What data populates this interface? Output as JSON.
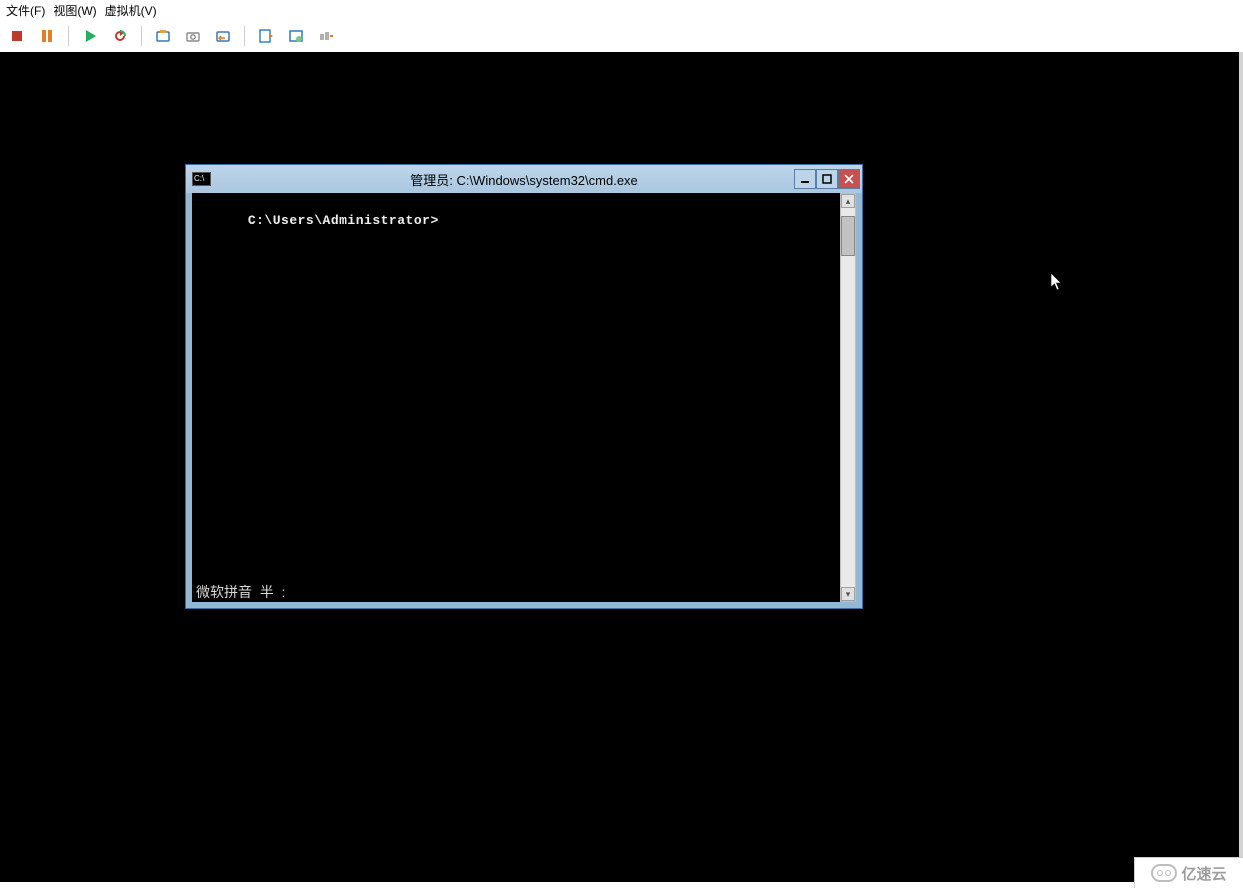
{
  "menubar": {
    "file": "文件(F)",
    "view": "视图(W)",
    "vm": "虚拟机(V)"
  },
  "toolbar": {
    "stop": "停止",
    "pause": "暂停",
    "play": "运行",
    "restart": "重新启动",
    "snapshot": "快照",
    "camera": "截图",
    "settings": "设置",
    "install_tools": "安装工具",
    "fullscreen": "全屏",
    "unity": "统一模式"
  },
  "cmd": {
    "title": "管理员: C:\\Windows\\system32\\cmd.exe",
    "icon_text": "C:\\",
    "prompt": "C:\\Users\\Administrator>",
    "ime_status": "微软拼音  半  :"
  },
  "watermark": {
    "text": "亿速云"
  }
}
